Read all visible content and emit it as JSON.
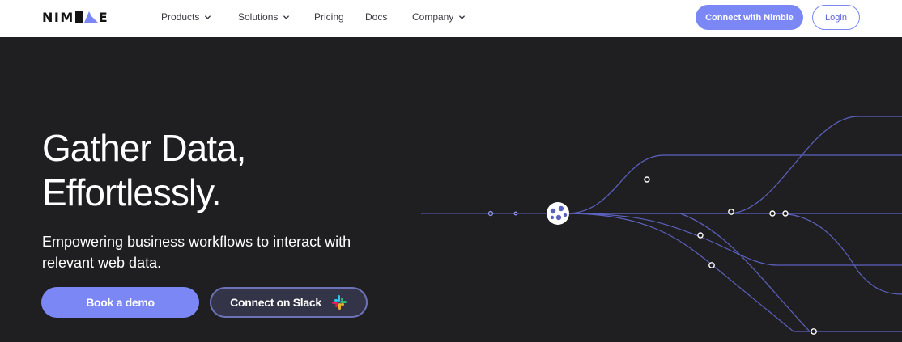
{
  "nav": {
    "logo": {
      "text_left": "NIM",
      "text_right": "E",
      "icon": "nimble-logo-icon"
    },
    "items": [
      {
        "label": "Products",
        "has_dropdown": true
      },
      {
        "label": "Solutions",
        "has_dropdown": true
      },
      {
        "label": "Pricing",
        "has_dropdown": false
      },
      {
        "label": "Docs",
        "has_dropdown": false
      },
      {
        "label": "Company",
        "has_dropdown": true
      }
    ],
    "connect_label": "Connect with Nimble",
    "login_label": "Login"
  },
  "hero": {
    "title_line1": "Gather Data,",
    "title_line2": "Effortlessly.",
    "subtitle": "Empowering business workflows to interact with relevant web data.",
    "demo_label": "Book a demo",
    "slack_label": "Connect on Slack",
    "slack_icon": "slack-icon",
    "hub_icon": "data-hub-icon"
  },
  "colors": {
    "accent": "#7a87f5",
    "hero_bg": "#1f1e20",
    "line": "#5c62c0",
    "slack_btn_bg": "#333447"
  }
}
